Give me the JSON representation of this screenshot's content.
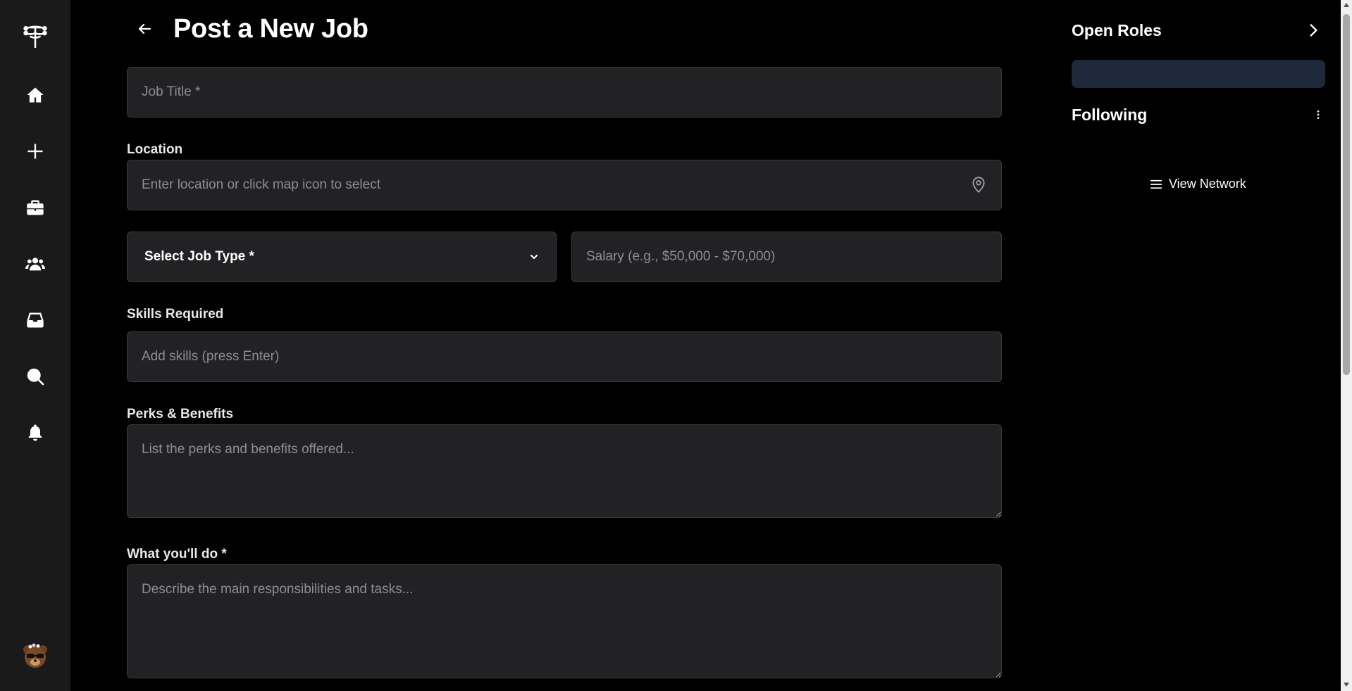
{
  "sidebar": {
    "icons": [
      "logo-icon",
      "home-icon",
      "plus-icon",
      "briefcase-icon",
      "users-icon",
      "inbox-icon",
      "search-icon",
      "bell-icon",
      "avatar"
    ]
  },
  "form": {
    "title": "Post a New Job",
    "job_title_placeholder": "Job Title *",
    "location_label": "Location",
    "location_placeholder": "Enter location or click map icon to select",
    "job_type_selected": "Select Job Type *",
    "salary_placeholder": "Salary (e.g., $50,000 - $70,000)",
    "skills_label": "Skills Required",
    "skills_placeholder": "Add skills (press Enter)",
    "perks_label": "Perks & Benefits",
    "perks_placeholder": "List the perks and benefits offered...",
    "duties_label": "What you'll do *",
    "duties_placeholder": "Describe the main responsibilities and tasks..."
  },
  "right_panel": {
    "open_roles_title": "Open Roles",
    "following_title": "Following",
    "view_network_label": "View Network"
  },
  "colors": {
    "background": "#000000",
    "sidebar": "#1a1a1a",
    "field": "#222224",
    "field_border": "#3a3a3e",
    "placeholder": "#8e8e93",
    "open_roles_bar": "#1e2a3b"
  }
}
